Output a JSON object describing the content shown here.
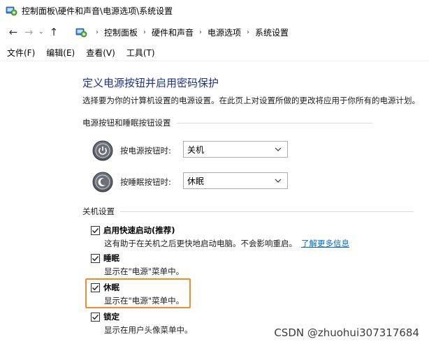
{
  "window": {
    "title": "控制面板\\硬件和声音\\电源选项\\系统设置"
  },
  "nav": {
    "back_glyph": "←",
    "forward_glyph": "→",
    "recent_glyph": "⌄",
    "up_glyph": "↑",
    "separator_glyph": "›",
    "breadcrumbs": [
      "控制面板",
      "硬件和声音",
      "电源选项",
      "系统设置"
    ]
  },
  "menu": {
    "items": [
      "文件(F)",
      "编辑(E)",
      "查看(V)",
      "工具(T)"
    ]
  },
  "page": {
    "title": "定义电源按钮并启用密码保护",
    "description": "选择要为你的计算机设置的电源设置。在此页上对设置所做的更改将应用于你所有的电源计划。"
  },
  "power_buttons_section": {
    "header": "电源按钮和睡眠按钮设置",
    "power_button": {
      "label": "按电源按钮时:",
      "value": "关机"
    },
    "sleep_button": {
      "label": "按睡眠按钮时:",
      "value": "休眠"
    }
  },
  "shutdown_section": {
    "header": "关机设置",
    "options": [
      {
        "title": "启用快速启动(推荐)",
        "checked": true,
        "desc": "这有助于在关机之后更快地启动电脑。不会影响重启。",
        "link": "了解更多信息"
      },
      {
        "title": "睡眠",
        "checked": true,
        "desc": "显示在\"电源\"菜单中。"
      },
      {
        "title": "休眠",
        "checked": true,
        "desc": "显示在\"电源\"菜单中。"
      },
      {
        "title": "锁定",
        "checked": true,
        "desc": "显示在用户头像菜单中。"
      }
    ]
  },
  "watermark": "CSDN @zhuohui307317684",
  "colors": {
    "title_blue": "#1e3287",
    "link_blue": "#0066cc",
    "highlight_orange": "#f08c2e"
  }
}
